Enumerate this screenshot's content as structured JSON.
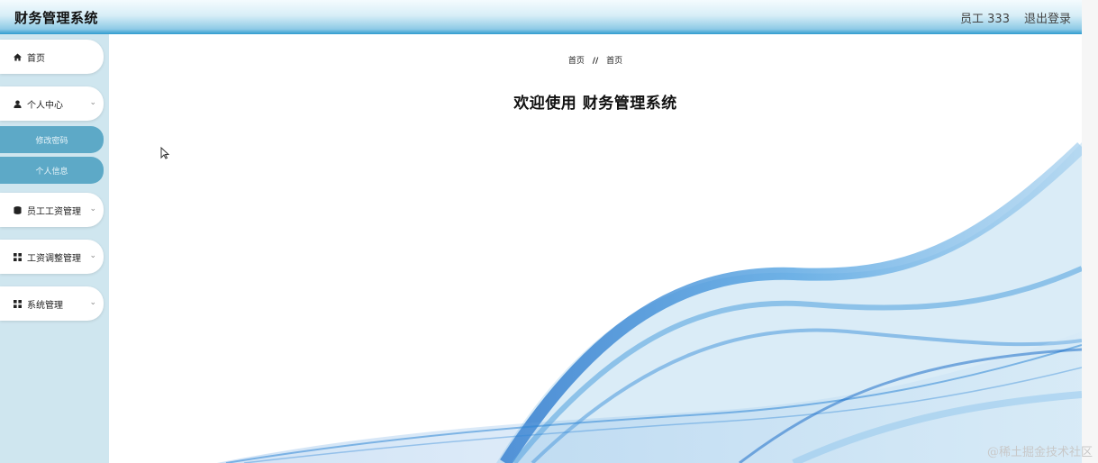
{
  "header": {
    "app_title": "财务管理系统",
    "user_label": "员工 333",
    "logout_label": "退出登录"
  },
  "sidebar": {
    "items": [
      {
        "label": "首页",
        "icon": "home-icon"
      },
      {
        "label": "个人中心",
        "icon": "user-icon"
      },
      {
        "label": "员工工资管理",
        "icon": "database-icon"
      },
      {
        "label": "工资调整管理",
        "icon": "grid-icon"
      },
      {
        "label": "系统管理",
        "icon": "grid-icon"
      }
    ],
    "personal_sub": [
      {
        "label": "修改密码"
      },
      {
        "label": "个人信息"
      }
    ]
  },
  "main": {
    "breadcrumb_home": "首页",
    "breadcrumb_sep": "//",
    "breadcrumb_current": "首页",
    "welcome": "欢迎使用 财务管理系统"
  },
  "watermark": "@稀土掘金技术社区",
  "colors": {
    "sidebar_bg": "#cfe6ef",
    "submenu_bg": "#5da9c7",
    "wave_blue": "#2f86d6"
  }
}
